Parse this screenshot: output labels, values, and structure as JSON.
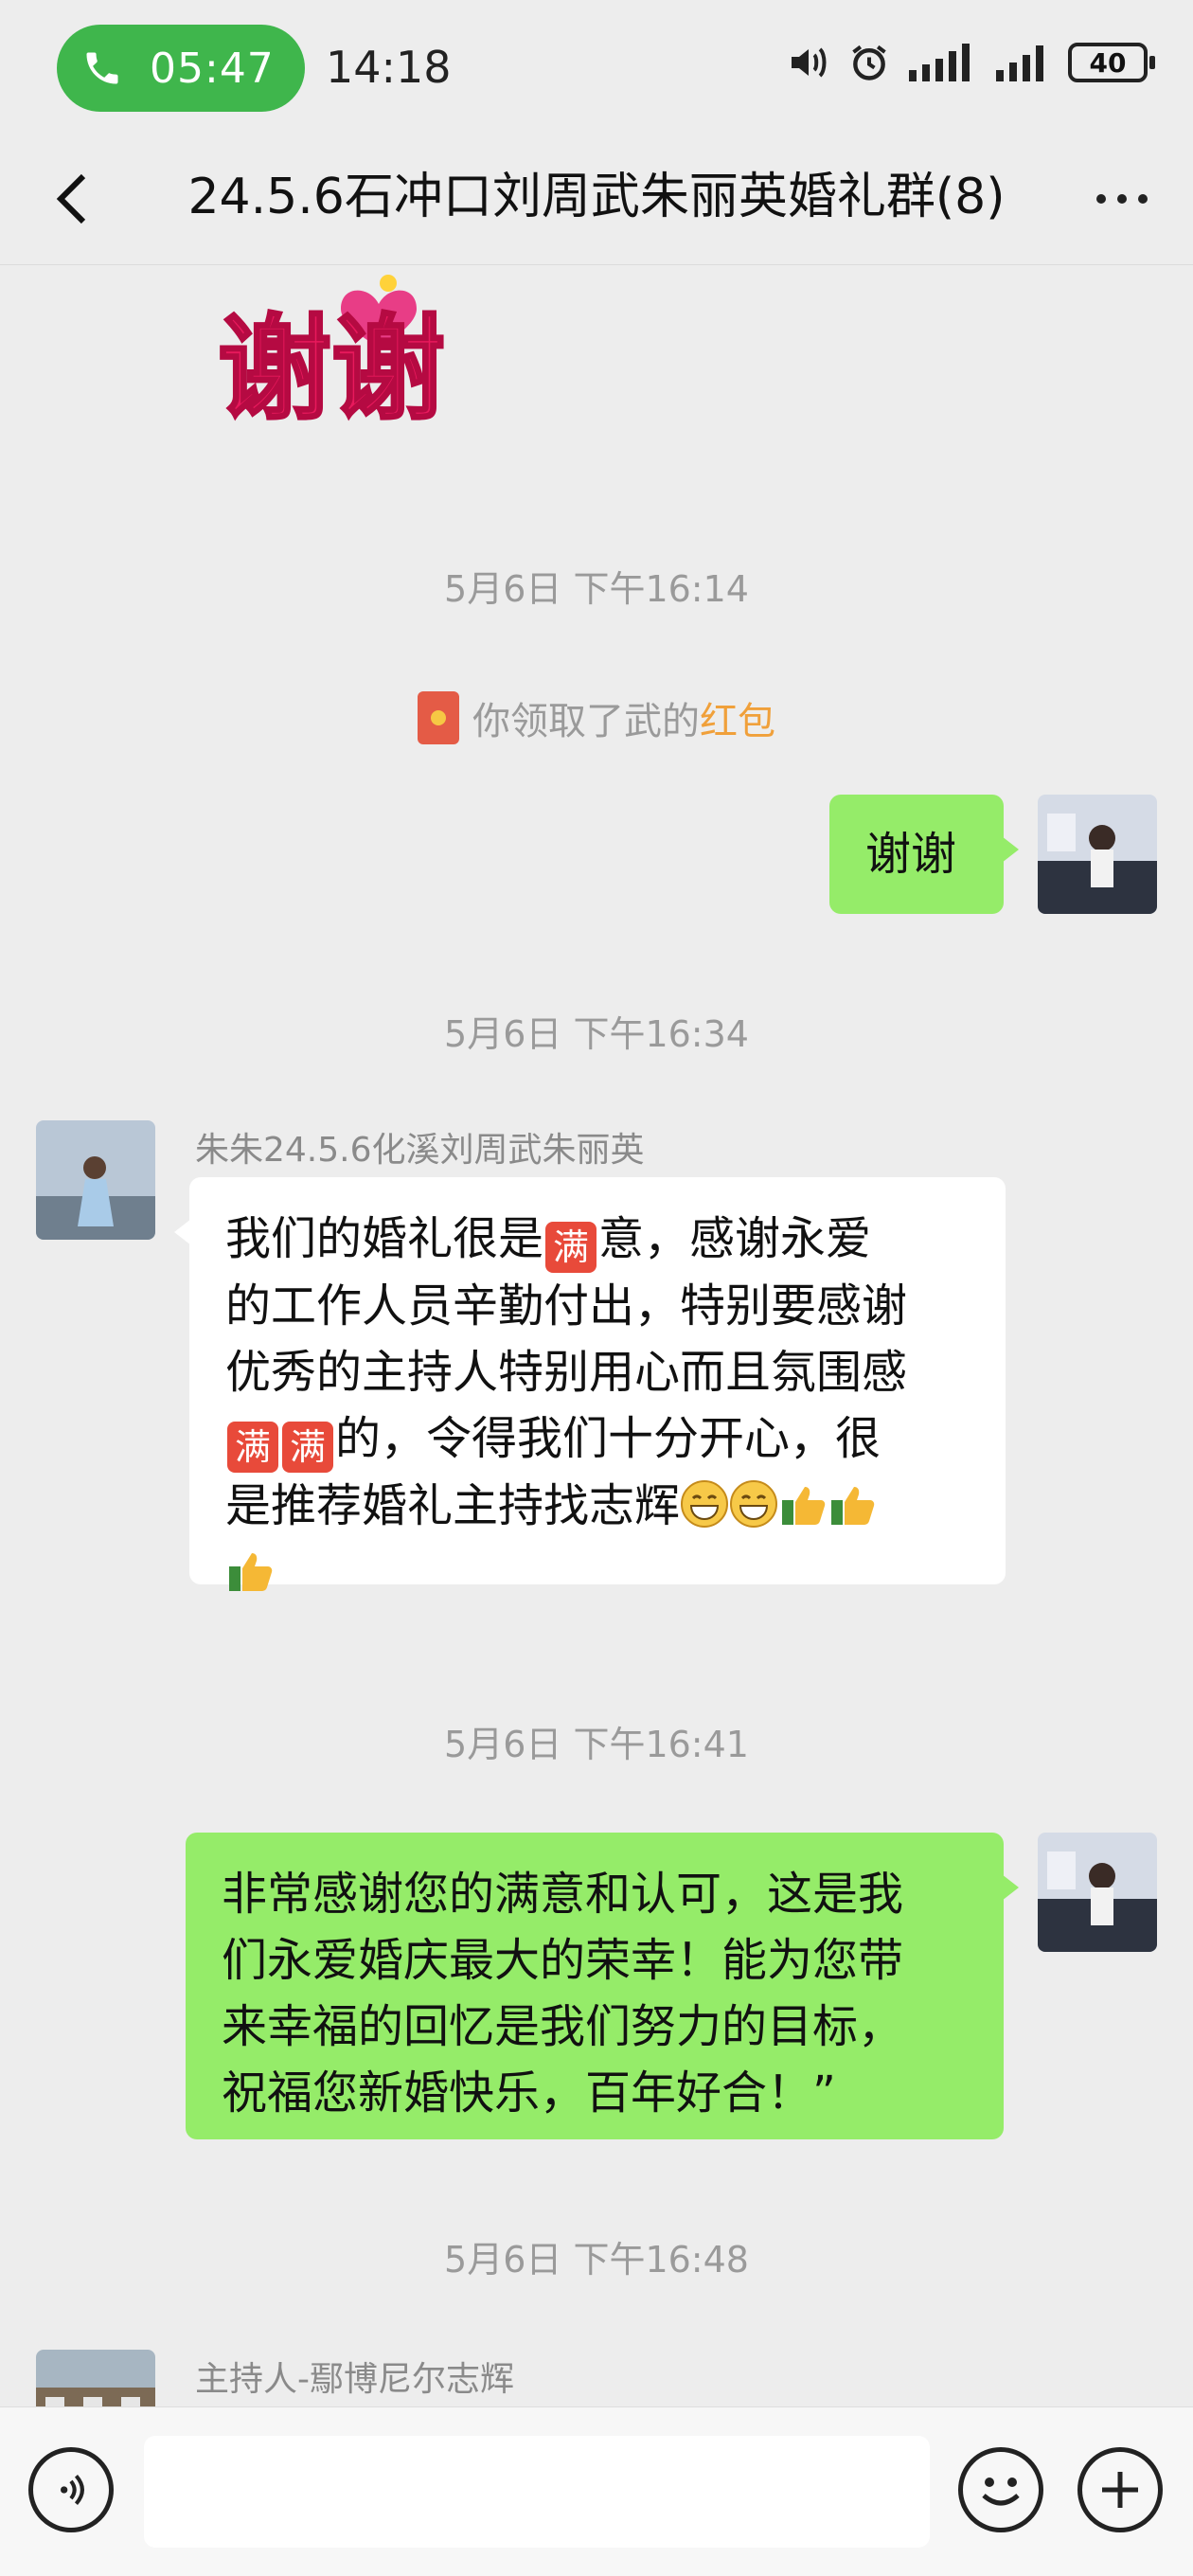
{
  "status_bar": {
    "call_time": "05:47",
    "clock": "14:18",
    "battery": "40"
  },
  "header": {
    "title": "24.5.6石冲口刘周武朱丽英婚礼群(8)"
  },
  "messages": {
    "sticker_text": "谢谢",
    "ts1": "5月6日 下午16:14",
    "system_prefix": "你领取了武的",
    "system_link": "红包",
    "reply1": "谢谢",
    "ts2": "5月6日 下午16:34",
    "sender1": "朱朱24.5.6化溪刘周武朱丽英",
    "msg1_line1a": "我们的婚礼很是",
    "msg1_line1b": "意，感谢永爱",
    "msg1_line2": "的工作人员辛勤付出，特别要感谢",
    "msg1_line3": "优秀的主持人特别用心而且氛围感",
    "msg1_line4b": "的，令得我们十分开心，很",
    "msg1_line5": "是推荐婚礼主持找志辉",
    "man_badge": "满",
    "ts3": "5月6日 下午16:41",
    "reply2_line1": "非常感谢您的满意和认可，这是我",
    "reply2_line2": "们永爱婚庆最大的荣幸！能为您带",
    "reply2_line3": "来幸福的回忆是我们努力的目标，",
    "reply2_line4": "祝福您新婚快乐，百年好合！”",
    "ts4": "5月6日 下午16:48",
    "sender2": "主持人-鄢博尼尔志辉"
  },
  "input": {
    "placeholder": ""
  },
  "colors": {
    "green_bubble": "#95ec69",
    "call_pill": "#3fb64c",
    "background": "#ededed"
  }
}
